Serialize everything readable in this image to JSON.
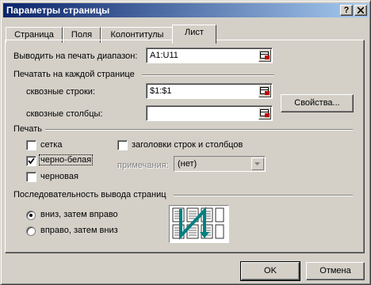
{
  "window": {
    "title": "Параметры страницы",
    "help_label": "?",
    "close_label": "X"
  },
  "tabs": [
    {
      "label": "Страница",
      "active": false
    },
    {
      "label": "Поля",
      "active": false
    },
    {
      "label": "Колонтитулы",
      "active": false
    },
    {
      "label": "Лист",
      "active": true
    }
  ],
  "print_area": {
    "label": "Выводить на печать диапазон:",
    "value": "A1:U11"
  },
  "print_titles": {
    "section_label": "Печатать на каждой странице",
    "rows_label": "сквозные строки:",
    "rows_value": "$1:$1",
    "cols_label": "сквозные столбцы:",
    "cols_value": ""
  },
  "properties_button": "Свойства...",
  "print": {
    "section_label": "Печать",
    "gridlines_label": "сетка",
    "gridlines_checked": false,
    "black_white_label": "черно-белая",
    "black_white_checked": true,
    "draft_label": "черновая",
    "draft_checked": false,
    "headings_label": "заголовки строк и столбцов",
    "headings_checked": false,
    "comments_label": "примечания:",
    "comments_value": "(нет)"
  },
  "page_order": {
    "section_label": "Последовательность вывода страниц",
    "down_then_over_label": "вниз, затем вправо",
    "down_then_over_selected": true,
    "over_then_down_label": "вправо, затем вниз",
    "over_then_down_selected": false
  },
  "buttons": {
    "ok": "OK",
    "cancel": "Отмена"
  },
  "colors": {
    "title_start": "#0a246a",
    "title_end": "#a6caf0",
    "face": "#d4d0c8",
    "order_arrow": "#008080"
  },
  "icons": [
    "help-icon",
    "close-icon",
    "range-select-icon",
    "checkmark-icon",
    "dropdown-arrow-icon",
    "page-order-icon"
  ]
}
